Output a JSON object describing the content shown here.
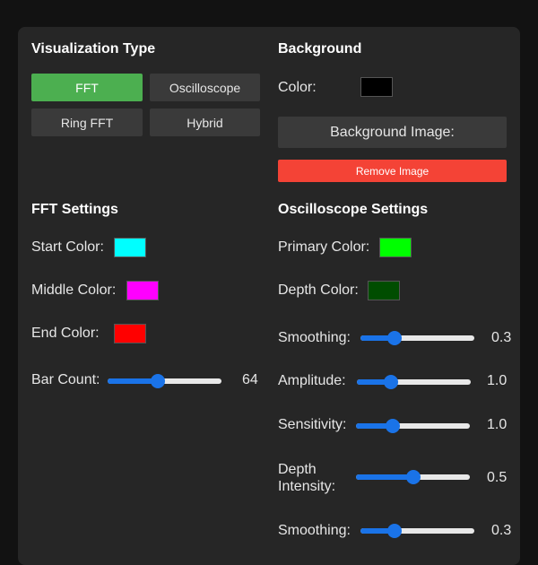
{
  "visualization": {
    "title": "Visualization Type",
    "buttons": [
      "FFT",
      "Oscilloscope",
      "Ring FFT",
      "Hybrid"
    ],
    "selected": "FFT"
  },
  "background": {
    "title": "Background",
    "color_label": "Color:",
    "color": "#000000",
    "image_button": "Background Image:",
    "remove_button": "Remove Image"
  },
  "fft": {
    "title": "FFT Settings",
    "start_label": "Start Color:",
    "start_color": "#00ffff",
    "middle_label": "Middle Color:",
    "middle_color": "#ff00ff",
    "end_label": "End Color:",
    "end_color": "#ff0000",
    "bar_count_label": "Bar Count:",
    "bar_count_value": "64",
    "bar_count_fraction": 0.44
  },
  "oscilloscope": {
    "title": "Oscilloscope Settings",
    "primary_label": "Primary Color:",
    "primary_color": "#00ff00",
    "depth_label": "Depth Color:",
    "depth_color": "#004d00",
    "sliders": [
      {
        "label": "Smoothing:",
        "value": "0.3",
        "fraction": 0.3
      },
      {
        "label": "Amplitude:",
        "value": "1.0",
        "fraction": 0.3
      },
      {
        "label": "Sensitivity:",
        "value": "1.0",
        "fraction": 0.32
      },
      {
        "label_line1": "Depth",
        "label_line2": "Intensity:",
        "value": "0.5",
        "fraction": 0.5
      },
      {
        "label": "Smoothing:",
        "value": "0.3",
        "fraction": 0.3
      }
    ]
  },
  "colors": {
    "accent": "#4caf50",
    "danger": "#f44336",
    "slider": "#1a73e8"
  }
}
